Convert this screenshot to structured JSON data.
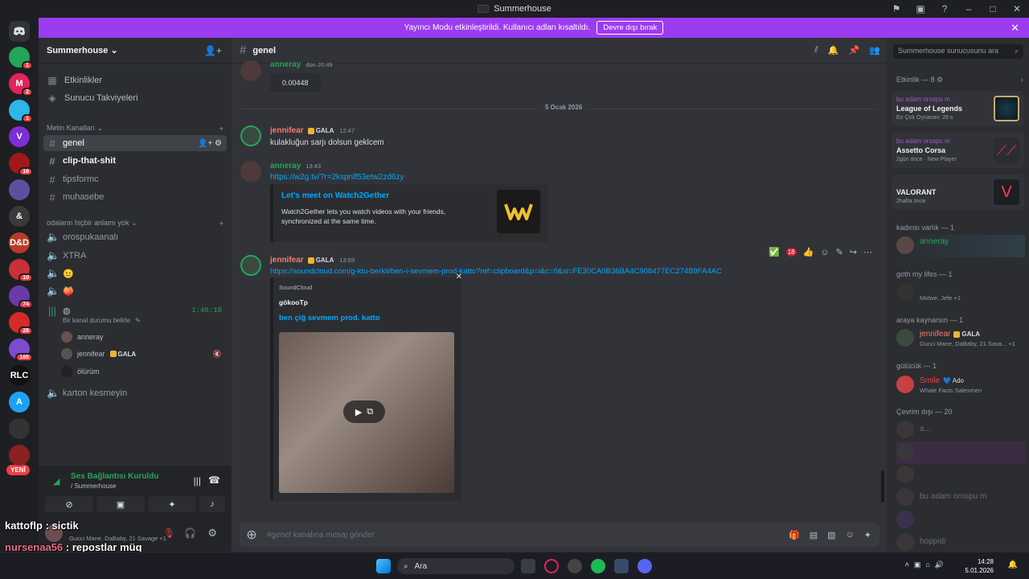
{
  "window": {
    "title": "Summerhouse"
  },
  "banner": {
    "text": "Yayıncı Modu etkinleştirildi. Kullanıcı adları kısaltıldı.",
    "button": "Devre dışı bırak"
  },
  "servers": [
    {
      "label": "",
      "badge": "1",
      "color": "#23a55a"
    },
    {
      "label": "M",
      "badge": "2",
      "color": "#e0245e"
    },
    {
      "label": "",
      "badge": "1",
      "color": "#2fb5e8"
    },
    {
      "label": "V",
      "badge": "",
      "color": "#7b2fd6"
    },
    {
      "label": "",
      "badge": "16",
      "color": "#a01818"
    },
    {
      "label": "",
      "badge": "",
      "color": "#5c4fa0"
    },
    {
      "label": "&",
      "badge": "",
      "color": "#3a3a3a"
    },
    {
      "label": "D&D",
      "badge": "",
      "color": "#b83a2a"
    },
    {
      "label": "",
      "badge": "10",
      "color": "#c9303a"
    },
    {
      "label": "",
      "badge": "74",
      "color": "#6a3aa8"
    },
    {
      "label": "",
      "badge": "28",
      "color": "#d62a2a"
    },
    {
      "label": "",
      "badge": "165",
      "color": "#7e4bcf"
    },
    {
      "label": "RLC",
      "badge": "",
      "color": "#111111"
    },
    {
      "label": "A",
      "badge": "",
      "color": "#1da1f2"
    },
    {
      "label": "",
      "badge": "",
      "color": "#333333"
    },
    {
      "label": "",
      "badge": "",
      "color": "#8a2020"
    }
  ],
  "new_badge": "YENİ",
  "sidebar": {
    "server_name": "Summerhouse",
    "items": [
      {
        "label": "Etkinlikler"
      },
      {
        "label": "Sunucu Takviyeleri"
      }
    ],
    "text_category": "Metin Kanalları",
    "text_channels": [
      "genel",
      "clip-that-shit",
      "tipsformc",
      "muhasebe"
    ],
    "voice_category": "odaların hiçbir anlamı yok",
    "voice_channels": [
      "orospukaanalı",
      "XTRA",
      "😐",
      "🍑"
    ],
    "live_channel": {
      "timer": "1:46:10",
      "status": "Bir kanal durumu belirle"
    },
    "voice_users": [
      {
        "name": "anneray",
        "tag": ""
      },
      {
        "name": "jennifear",
        "tag": "GALA"
      },
      {
        "name": "ölürüm",
        "tag": ""
      }
    ],
    "extra_channel": "karton kesmeyin"
  },
  "voice_panel": {
    "status": "Ses Bağlantısı Kuruldu",
    "sub": "/ Summerhouse"
  },
  "user_panel": {
    "activity": "Gucci Mane, DaBaby, 21 Savage +1"
  },
  "overlay": [
    {
      "name": "kattoflp",
      "msg": "sictik"
    },
    {
      "name": "nursenaa56",
      "msg": "repostlar müq"
    },
    {
      "name": "kattoflp",
      "msg": ""
    }
  ],
  "chat": {
    "channel": "genel",
    "placeholder": "#genel kanalına mesaj gönder",
    "date_divider": "5 Ocak 2026",
    "messages": [
      {
        "user": "anneray",
        "time": "dün 20:49",
        "text": "0.00448"
      },
      {
        "user": "jennifear",
        "tag": "GALA",
        "time": "12:47",
        "text": "kulakluğun sarjı dolsun geklcem"
      },
      {
        "user": "anneray",
        "time": "13:43",
        "link": "https://w2g.tv/?r=2kspnlf53etw2zd6zy",
        "embed": {
          "title": "Let's meet on Watch2Gether",
          "desc": "Watch2Gether lets you watch videos with your friends, synchronized at the same time."
        }
      },
      {
        "user": "jennifear",
        "tag": "GALA",
        "time": "13:59",
        "link": "https://soundcloud.com/g-ktu-berkil/ben-i-sevmem-prod-katto?ref=clipboard&p=i&c=0&si=FE30CA0B36BA4C908477EC274B9FA4AC",
        "embed": {
          "provider": "SoundCloud",
          "author": "gökooTp",
          "title": "ben çiğ sevmem prod. katto"
        }
      }
    ],
    "reaction_count": "18"
  },
  "members": {
    "search_placeholder": "Summerhouse sunucusunu ara",
    "activity_header": "Etkinlik — 8",
    "activities": [
      {
        "user": "bu adam orospu m",
        "game": "League of Legends",
        "detail": "En Çok Oynanan: 26 s"
      },
      {
        "user": "bu adam orospu m",
        "game": "Assetto Corsa",
        "detail": "2gün önce · New Player"
      },
      {
        "user": "",
        "game": "VALORANT",
        "detail": "2hafta önce"
      }
    ],
    "groups": [
      {
        "title": "kadınsı varlık — 1",
        "members": [
          {
            "name": "anneray",
            "sub": "",
            "color": "#23a55a"
          }
        ]
      },
      {
        "title": "goth my lifes — 1",
        "members": [
          {
            "name": "",
            "sub": "Motive, Jefe +1",
            "color": "#a358c2"
          }
        ]
      },
      {
        "title": "araya kaynarsın — 1",
        "members": [
          {
            "name": "jennifear",
            "sub": "Gucci Mane, DaBaby, 21 Sava... +1",
            "color": "#f47b67"
          }
        ]
      },
      {
        "title": "gülücük — 1",
        "members": [
          {
            "name": "Smile",
            "tag": "Ado",
            "sub": "Whale Facts Salesmen",
            "color": "#f23f43"
          }
        ]
      }
    ],
    "offline_header": "Çevrim dışı — 20",
    "offline": [
      "a...",
      "",
      "",
      "bu adam orospu m",
      "",
      "hoppidi"
    ]
  },
  "taskbar": {
    "search": "Ara",
    "time": "14:28",
    "date": "5.01.2026"
  }
}
